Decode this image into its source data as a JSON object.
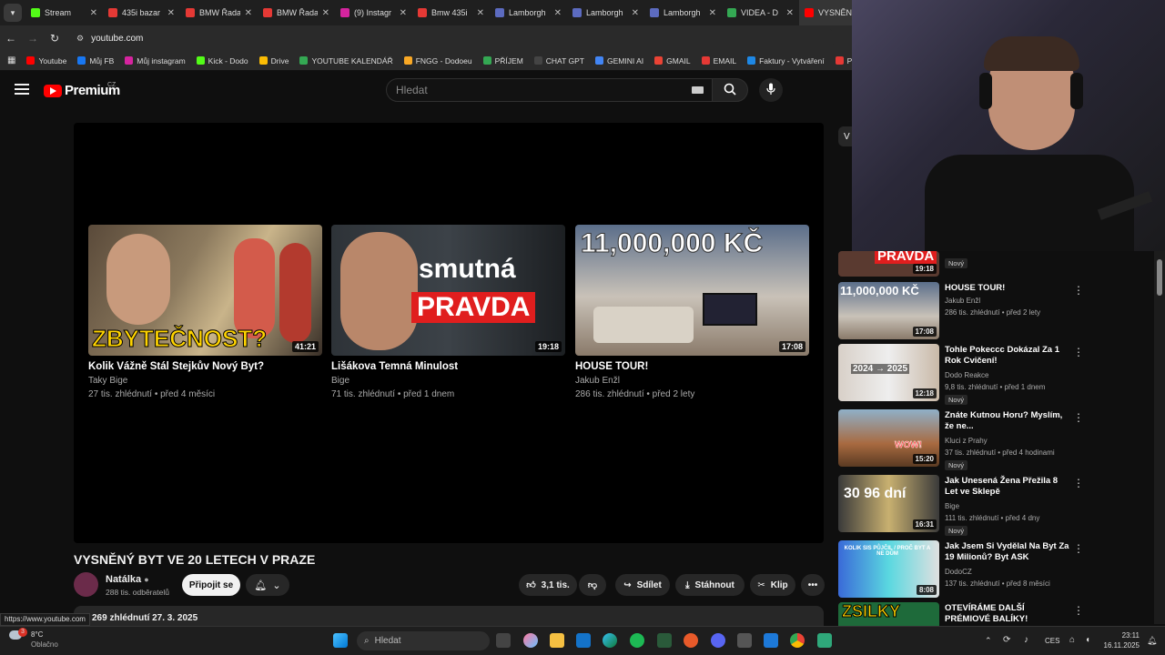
{
  "browser": {
    "tabs": [
      {
        "label": "Stream",
        "color": "#53fc18"
      },
      {
        "label": "435i bazar",
        "color": "#e53935"
      },
      {
        "label": "BMW Řada",
        "color": "#e53935"
      },
      {
        "label": "BMW Řada",
        "color": "#e53935"
      },
      {
        "label": "(9) Instagr",
        "color": "#d6249f"
      },
      {
        "label": "Bmw 435i",
        "color": "#e53935"
      },
      {
        "label": "Lamborgh",
        "color": "#5c6bc0"
      },
      {
        "label": "Lamborgh",
        "color": "#5c6bc0"
      },
      {
        "label": "Lamborgh",
        "color": "#5c6bc0"
      },
      {
        "label": "VIDEA - D",
        "color": "#34a853"
      },
      {
        "label": "VYSNĚNÝ",
        "color": "#ff0000"
      }
    ],
    "url": "youtube.com",
    "bookmarks": [
      {
        "label": "Youtube",
        "color": "#ff0000"
      },
      {
        "label": "Můj FB",
        "color": "#1877f2"
      },
      {
        "label": "Můj instagram",
        "color": "#d6249f"
      },
      {
        "label": "Kick - Dodo",
        "color": "#53fc18"
      },
      {
        "label": "Drive",
        "color": "#fbbc04"
      },
      {
        "label": "YOUTUBE KALENDÁŘ",
        "color": "#34a853"
      },
      {
        "label": "FNGG - Dodoeu",
        "color": "#f9a825"
      },
      {
        "label": "PŘÍJEM",
        "color": "#34a853"
      },
      {
        "label": "CHAT GPT",
        "color": "#444444"
      },
      {
        "label": "GEMINI AI",
        "color": "#4285f4"
      },
      {
        "label": "GMAIL",
        "color": "#ea4335"
      },
      {
        "label": "EMAIL",
        "color": "#e53935"
      },
      {
        "label": "Faktury - Vytváření",
        "color": "#1e88e5"
      },
      {
        "label": "PNG to PDF",
        "color": "#e53935"
      }
    ]
  },
  "youtube": {
    "logo_word": "Premium",
    "logo_country": "CZ",
    "search_placeholder": "Hledat",
    "end_cards": [
      {
        "title": "Kolik Vážně Stál Stejkův Nový Byt?",
        "channel": "Taky Bige",
        "meta": "27 tis. zhlédnutí • před 4 měsíci",
        "duration": "41:21",
        "overlay": "ZBYTEČNOST?"
      },
      {
        "title": "Lišákova Temná Minulost",
        "channel": "Bige",
        "meta": "71 tis. zhlédnutí • před 1 dnem",
        "duration": "19:18",
        "overlay_top": "smutná",
        "overlay_bottom": "PRAVDA"
      },
      {
        "title": "HOUSE TOUR!",
        "channel": "Jakub Enžl",
        "meta": "286 tis. zhlédnutí • před 2 lety",
        "duration": "17:08",
        "overlay": "11,000,000 KČ"
      }
    ],
    "video": {
      "title": "VYSNĚNÝ BYT VE 20 LETECH V PRAZE",
      "channel": "Natálka",
      "subscribers": "288 tis. odběratelů",
      "join": "Připojit se",
      "likes": "3,1 tis.",
      "share": "Sdílet",
      "download": "Stáhnout",
      "clip": "Klip",
      "desc_line": "269 zhlédnutí  27. 3. 2025"
    },
    "sidebar_tab": "V",
    "related": [
      {
        "title": "",
        "channel": "",
        "meta": "",
        "new": "Nový",
        "duration": "19:18",
        "overlay": "PRAVDA"
      },
      {
        "title": "HOUSE TOUR!",
        "channel": "Jakub Enžl",
        "meta": "286 tis. zhlédnutí • před 2 lety",
        "new": "",
        "duration": "17:08",
        "overlay": "11,000,000 KČ"
      },
      {
        "title": "Tohle Pokeccc Dokázal Za 1 Rok Cvičení!",
        "channel": "Dodo Reakce",
        "meta": "9,8 tis. zhlédnutí • před 1 dnem",
        "new": "Nový",
        "duration": "12:18",
        "overlay": "2024 → 2025"
      },
      {
        "title": "Znáte Kutnou Horu? Myslím, že ne...",
        "channel": "Kluci z Prahy",
        "meta": "37 tis. zhlédnutí • před 4 hodinami",
        "new": "Nový",
        "duration": "15:20",
        "overlay": "WOW!"
      },
      {
        "title": "Jak Unesená Žena Přežila 8 Let ve Sklepě",
        "channel": "Bige",
        "meta": "111 tis. zhlédnutí • před 4 dny",
        "new": "Nový",
        "duration": "16:31",
        "overlay": "30 96 dní"
      },
      {
        "title": "Jak Jsem Si Vydělal Na Byt Za 19 Milionů? Byt ASK",
        "channel": "DodoCZ",
        "meta": "137 tis. zhlédnutí • před 8 měsíci",
        "new": "",
        "duration": "8:08",
        "overlay": "KOLIK SIS PŮJČIL / PROČ BYT A NE DŮM"
      },
      {
        "title": "OTEVÍRÁME DALŠÍ PRÉMIOVÉ BALÍKY!",
        "channel": "",
        "meta": "",
        "new": "",
        "duration": "",
        "overlay": "ZSILKY"
      }
    ]
  },
  "status_url": "https://www.youtube.com",
  "taskbar": {
    "weather_temp": "8°C",
    "weather_desc": "Oblačno",
    "weather_badge": "3",
    "search": "Hledat",
    "lang": "CES",
    "time": "23:11",
    "date": "16.11.2025"
  }
}
